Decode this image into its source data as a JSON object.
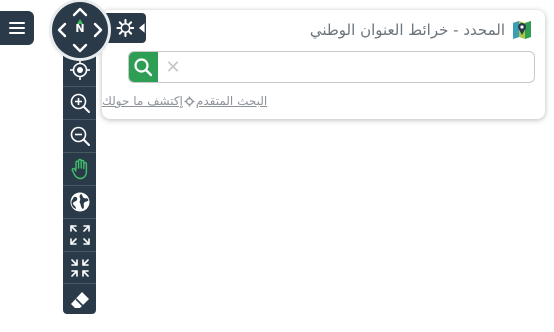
{
  "header": {
    "title": "المحدد - خرائط العنوان الوطني",
    "logo_icon": "map-pin-logo-icon"
  },
  "search": {
    "value": "",
    "placeholder": ""
  },
  "links": {
    "advanced_search": "البحث المتقدم",
    "explore_nearby": "إكتشف ما حولك"
  },
  "compass": {
    "north_label": "N"
  },
  "toolbar": {
    "tools": [
      {
        "name": "locate-icon"
      },
      {
        "name": "zoom-in-icon"
      },
      {
        "name": "zoom-out-icon"
      },
      {
        "name": "pan-hand-icon"
      },
      {
        "name": "globe-icon"
      },
      {
        "name": "full-extent-icon"
      },
      {
        "name": "shrink-icon"
      },
      {
        "name": "eraser-icon"
      }
    ]
  },
  "colors": {
    "toolbar_bg": "#2b3a48",
    "accent_green": "#2e9e55",
    "title_text": "#6b747c",
    "link_text": "#8e9399"
  }
}
